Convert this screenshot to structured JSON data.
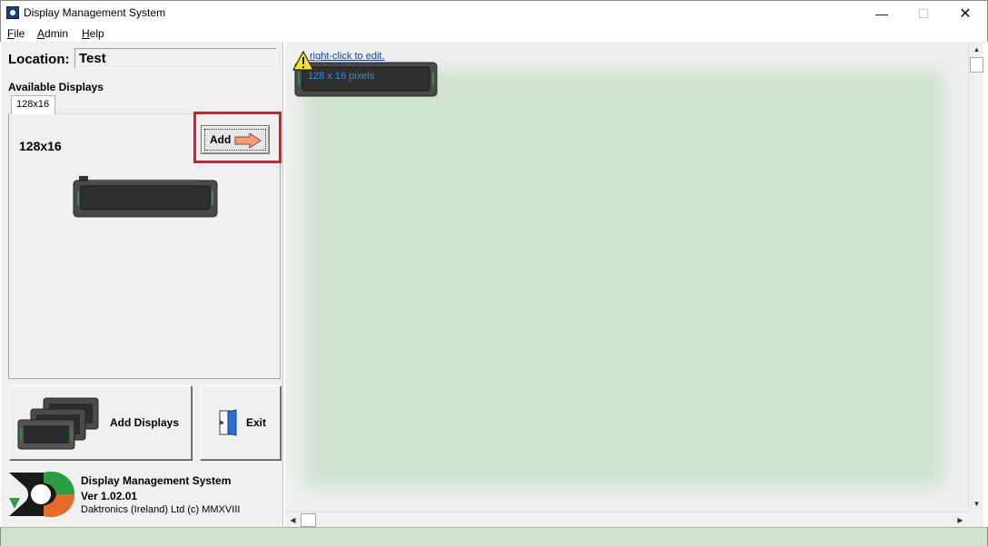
{
  "window": {
    "title": "Display Management System",
    "controls": {
      "minimize": "—",
      "maximize": "☐",
      "close": "✕"
    }
  },
  "menu": {
    "file": {
      "key": "F",
      "rest": "ile"
    },
    "admin": {
      "key": "A",
      "rest": "dmin"
    },
    "help": {
      "key": "H",
      "rest": "elp"
    }
  },
  "left": {
    "location_label": "Location:",
    "location_value": "Test",
    "available_label": "Available Displays",
    "tabs": [
      "128x16"
    ],
    "selected_display": "128x16",
    "add_button": "Add",
    "add_displays_button": "Add Displays",
    "exit_button": "Exit"
  },
  "about": {
    "title": "Display Management System",
    "version": "Ver 1.02.01",
    "copyright": "Daktronics (Ireland) Ltd (c) MMXVIII"
  },
  "canvas": {
    "hint_link": "right-click to edit.",
    "display_label": "128 x 16 pixels"
  },
  "colors": {
    "accent_red": "#e01b24",
    "canvas_green": "#cfe3cf",
    "link_blue": "#1f3f9a"
  }
}
